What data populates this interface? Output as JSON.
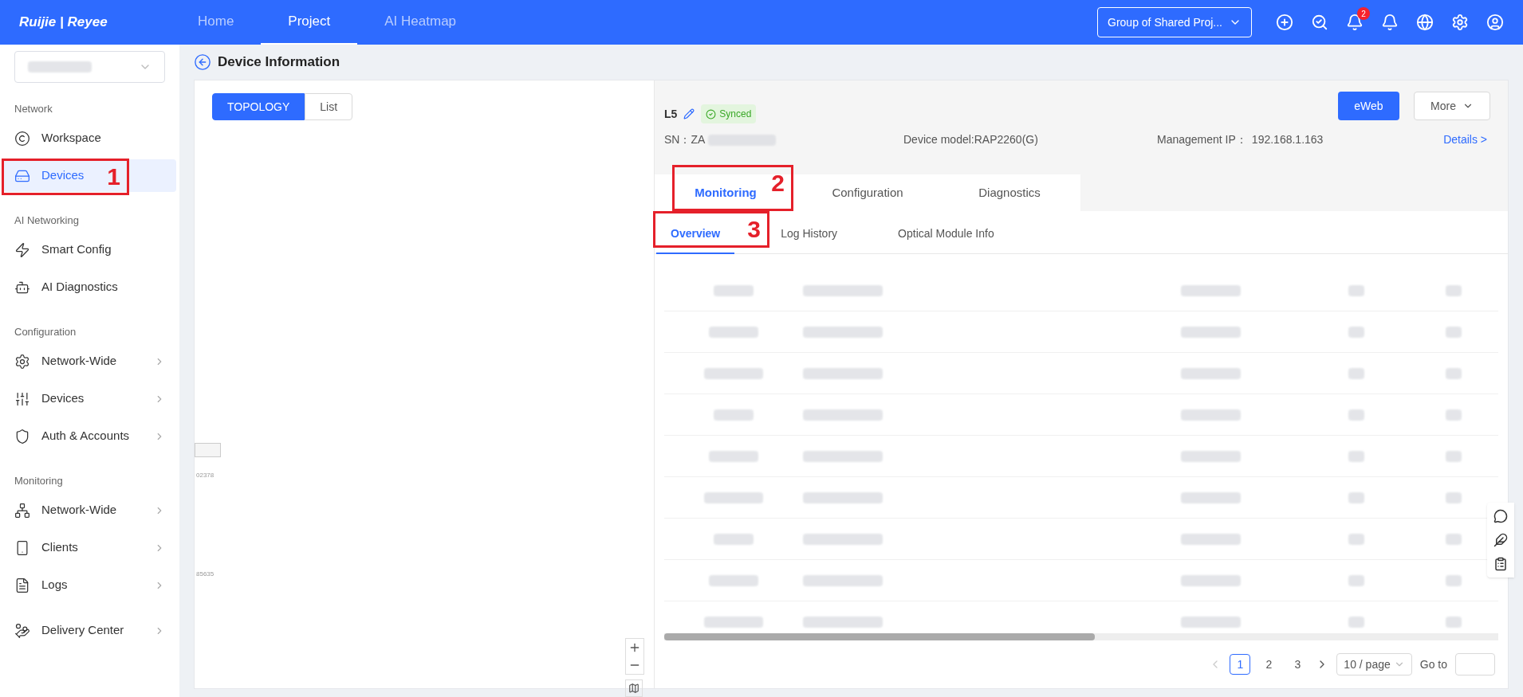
{
  "top_nav": {
    "brand": "Ruijie | Reyee",
    "items": [
      {
        "label": "Home",
        "selected": false
      },
      {
        "label": "Project",
        "selected": true
      },
      {
        "label": "AI Heatmap",
        "selected": false
      }
    ],
    "project_group": "Group of Shared Proj...",
    "notification_count": "2"
  },
  "sidebar": {
    "sections": [
      {
        "title": "Network",
        "items": [
          {
            "label": "Workspace",
            "selected": false,
            "has_children": false
          },
          {
            "label": "Devices",
            "selected": true,
            "has_children": false,
            "annotation": "1"
          }
        ]
      },
      {
        "title": "AI Networking",
        "items": [
          {
            "label": "Smart Config",
            "selected": false,
            "has_children": false
          },
          {
            "label": "AI Diagnostics",
            "selected": false,
            "has_children": false
          }
        ]
      },
      {
        "title": "Configuration",
        "items": [
          {
            "label": "Network-Wide",
            "selected": false,
            "has_children": true
          },
          {
            "label": "Devices",
            "selected": false,
            "has_children": true
          },
          {
            "label": "Auth & Accounts",
            "selected": false,
            "has_children": true
          }
        ]
      },
      {
        "title": "Monitoring",
        "items": [
          {
            "label": "Network-Wide",
            "selected": false,
            "has_children": true
          },
          {
            "label": "Clients",
            "selected": false,
            "has_children": true
          },
          {
            "label": "Logs",
            "selected": false,
            "has_children": true
          }
        ]
      },
      {
        "items": [
          {
            "label": "Delivery Center",
            "selected": false,
            "has_children": true
          }
        ]
      }
    ]
  },
  "page_title": "Device Information",
  "view_toggle": [
    {
      "label": "TOPOLOGY",
      "selected": true
    },
    {
      "label": "List",
      "selected": false
    }
  ],
  "topology_fragments": [
    "02378",
    "85635"
  ],
  "device": {
    "name": "L5",
    "status": "Synced",
    "sn_label": "SN：",
    "sn_value": "ZA",
    "model": "Device model:RAP2260(G)",
    "ip_label": "Management IP：",
    "ip_value": "192.168.1.163",
    "details_link": "Details >",
    "buttons": [
      "eWeb",
      "More"
    ]
  },
  "tabs": [
    {
      "label": "Monitoring",
      "selected": true,
      "annotation": "2"
    },
    {
      "label": "Configuration",
      "selected": false
    },
    {
      "label": "Diagnostics",
      "selected": false
    }
  ],
  "sub_tabs": [
    {
      "label": "Overview",
      "selected": true,
      "annotation": "3"
    },
    {
      "label": "Log History",
      "selected": false
    },
    {
      "label": "Optical Module Info",
      "selected": false
    }
  ],
  "pagination": {
    "pages": [
      {
        "label": "1",
        "selected": true
      },
      {
        "label": "2",
        "selected": false
      },
      {
        "label": "3",
        "selected": false
      }
    ],
    "page_size": "10 / page",
    "goto_label": "Go to"
  }
}
